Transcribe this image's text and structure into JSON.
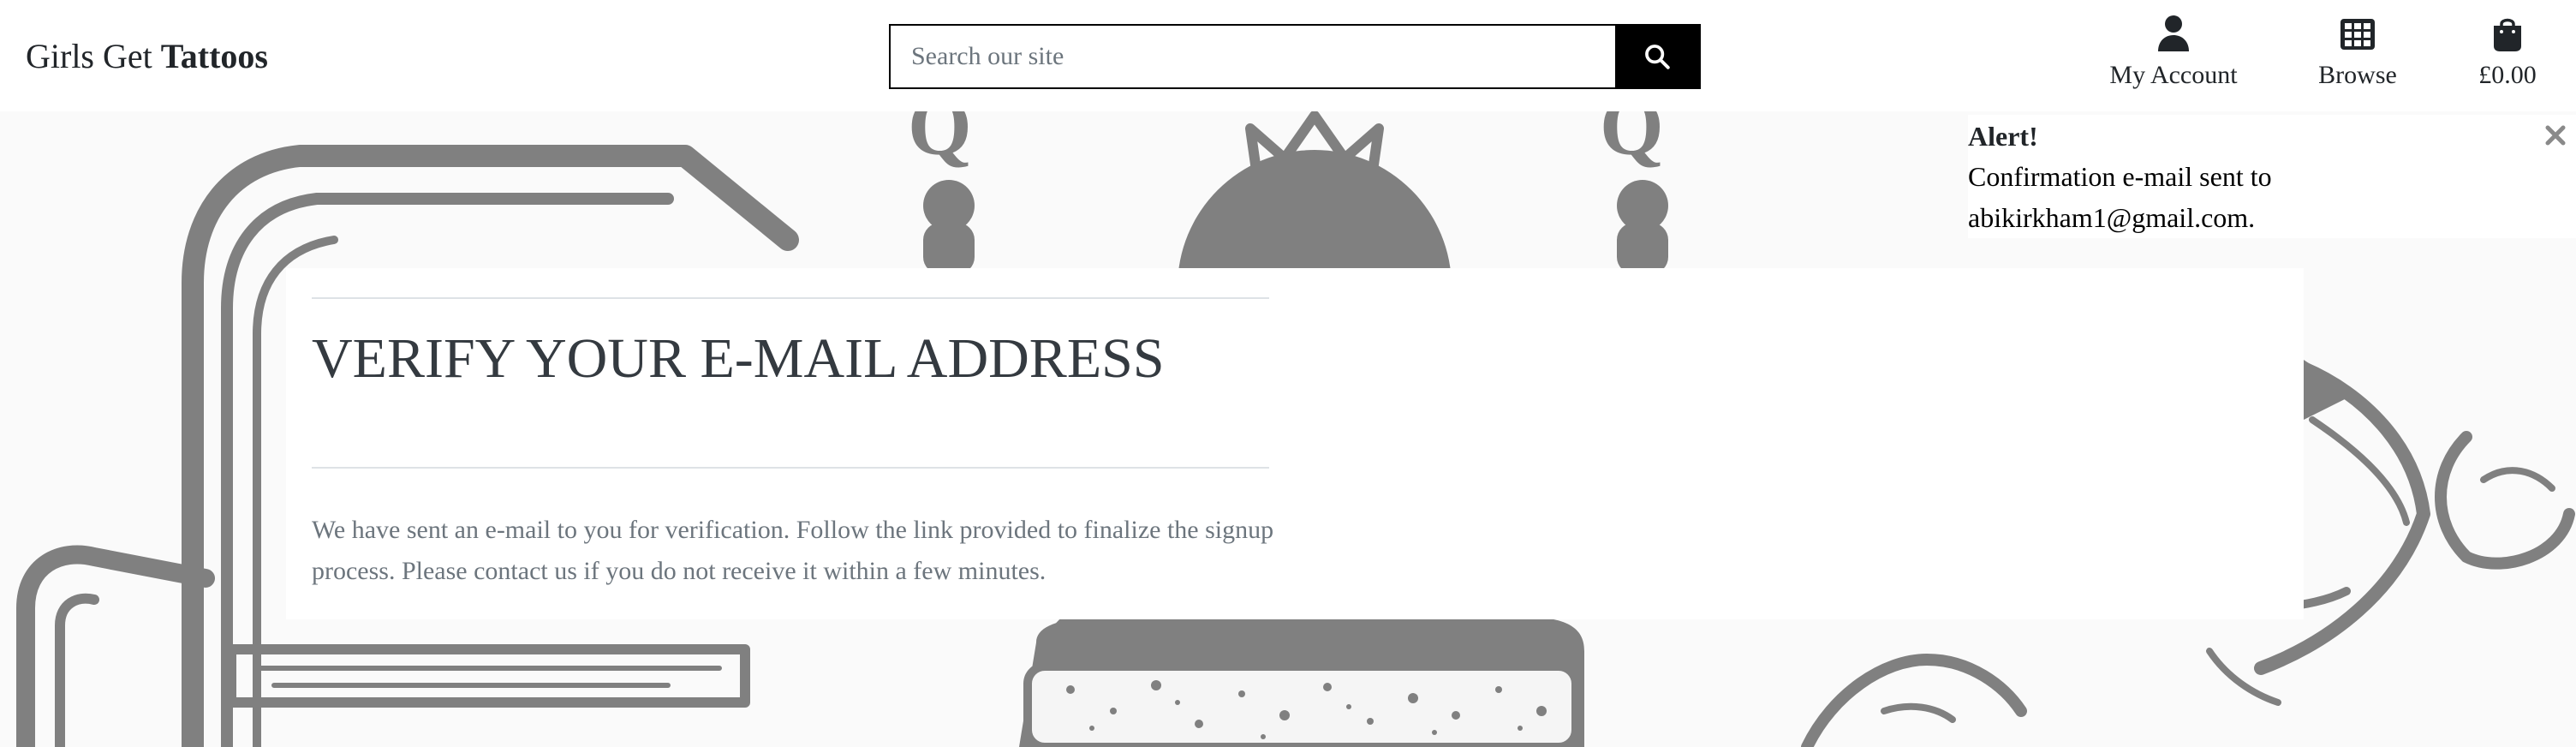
{
  "header": {
    "brand_prefix": "Girls Get",
    "brand_bold": "Tattoos",
    "search": {
      "placeholder": "Search our site",
      "button_icon": "search-icon"
    },
    "nav": {
      "account": {
        "label": "My Account",
        "icon": "user-icon"
      },
      "browse": {
        "label": "Browse",
        "icon": "grid-icon"
      },
      "bag": {
        "label": "£0.00",
        "icon": "shopping-bag-icon"
      }
    }
  },
  "main": {
    "title": "VERIFY YOUR E-MAIL ADDRESS",
    "message": "We have sent an e-mail to you for verification. Follow the link provided to finalize the signup process. Please contact us if you do not receive it within a few minutes."
  },
  "alert": {
    "title": "Alert!",
    "body": "Confirmation e-mail sent to abikirkham1@gmail.com.",
    "close_icon": "close-icon",
    "accent_color": "#2a8fb5"
  },
  "colors": {
    "artwork": "#808080",
    "background": "#fafafa",
    "search_button": "#000000"
  }
}
